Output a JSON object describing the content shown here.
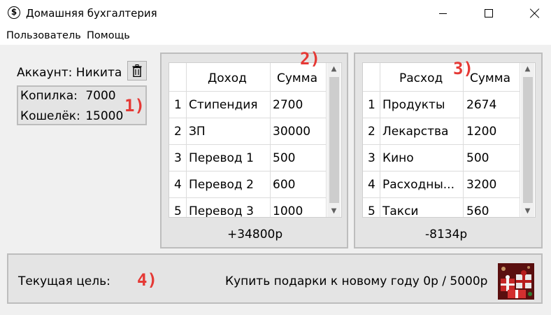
{
  "window": {
    "title": "Домашняя бухгалтерия",
    "icon": "dollar-circle-icon"
  },
  "menu": [
    "Пользователь",
    "Помощь"
  ],
  "account": {
    "label": "Аккаунт: Никита",
    "delete_icon": "trash-icon",
    "piggy_label": "Копилка:",
    "piggy_value": "7000",
    "wallet_label": "Кошелёк:",
    "wallet_value": "15000"
  },
  "markers": [
    "1)",
    "2)",
    "3)",
    "4)"
  ],
  "income": {
    "headers": [
      "Доход",
      "Сумма"
    ],
    "rows": [
      {
        "n": "1",
        "name": "Стипендия",
        "amount": "2700"
      },
      {
        "n": "2",
        "name": "ЗП",
        "amount": "30000"
      },
      {
        "n": "3",
        "name": "Перевод 1",
        "amount": "500"
      },
      {
        "n": "4",
        "name": "Перевод 2",
        "amount": "600"
      },
      {
        "n": "5",
        "name": "Перевод 3",
        "amount": "1000"
      }
    ],
    "total": "+34800р"
  },
  "expense": {
    "headers": [
      "Расход",
      "Сумма"
    ],
    "rows": [
      {
        "n": "1",
        "name": "Продукты",
        "amount": "2674"
      },
      {
        "n": "2",
        "name": "Лекарства",
        "amount": "1200"
      },
      {
        "n": "3",
        "name": "Кино",
        "amount": "500"
      },
      {
        "n": "4",
        "name": "Расходны...",
        "amount": "3200"
      },
      {
        "n": "5",
        "name": "Такси",
        "amount": "560"
      }
    ],
    "total": "-8134р"
  },
  "goal": {
    "label": "Текущая цель:",
    "text": "Купить подарки к новому году  0р / 5000р",
    "image": "gift-image"
  },
  "colors": {
    "marker": "#e53935",
    "panel_bg": "#e4e4e4",
    "panel_border": "#bdbdbd"
  }
}
